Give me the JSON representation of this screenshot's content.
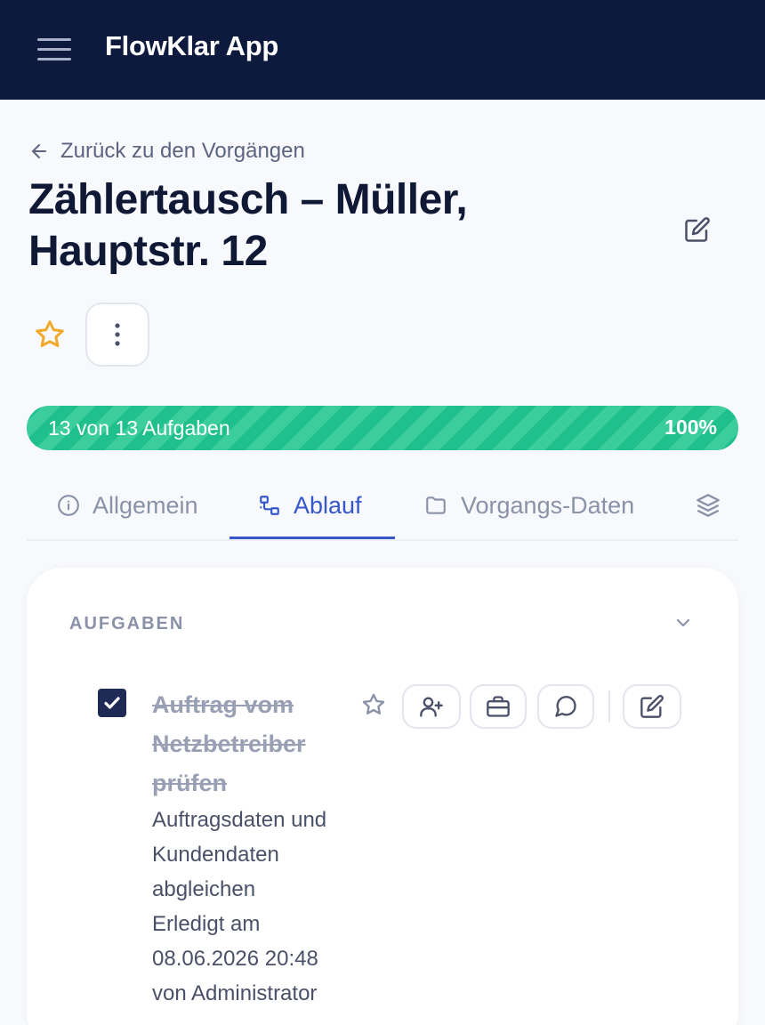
{
  "app": {
    "title": "FlowKlar App"
  },
  "nav": {
    "back_label": "Zurück zu den Vorgängen"
  },
  "page": {
    "title": "Zählertausch – Müller, Hauptstr. 12"
  },
  "progress": {
    "label": "13 von 13 Aufgaben",
    "percent_label": "100%",
    "fraction": 1.0
  },
  "tabs": [
    {
      "label": "Allgemein",
      "icon": "info-icon",
      "active": false
    },
    {
      "label": "Ablauf",
      "icon": "workflow-icon",
      "active": true
    },
    {
      "label": "Vorgangs-Daten",
      "icon": "folder-icon",
      "active": false
    },
    {
      "label": "",
      "icon": "layers-icon",
      "active": false
    }
  ],
  "tasks_section": {
    "header": "AUFGABEN",
    "tasks": [
      {
        "title": "Auftrag vom Netzbetreiber prüfen",
        "description": "Auftragsdaten und Kundendaten abgleichen",
        "completed_info": "Erledigt am 08.06.2026 20:48 von Administrator",
        "checked": true
      }
    ]
  },
  "colors": {
    "topbar": "#0e1a3d",
    "accent": "#3557c9",
    "progress": "#1fc08c",
    "star": "#f0a92a",
    "checkbox": "#1f2a55"
  }
}
